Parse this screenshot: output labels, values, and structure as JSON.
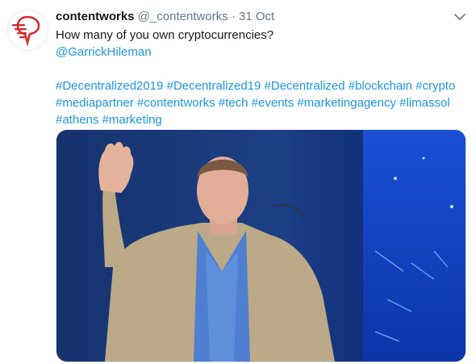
{
  "tweet": {
    "author_name": "contentworks",
    "author_handle": "@_contentworks",
    "separator": "·",
    "timestamp": "31 Oct",
    "text": "How many of you own cryptocurrencies?",
    "mention": "@GarrickHileman",
    "hashtags": [
      [
        "#Decentralized2019",
        "#Decentralized19",
        "#Decentralized",
        "#blockchain",
        "#crypto"
      ],
      [
        "#mediapartner",
        "#contentworks",
        "#tech",
        "#events",
        "#marketingagency",
        "#limassol"
      ],
      [
        "#athens",
        "#marketing"
      ]
    ],
    "avatar_icon": "contentworks-logo-icon",
    "menu_icon": "chevron-down-icon",
    "media_description_icon": "photo"
  },
  "colors": {
    "link": "#1b95e0",
    "secondary_text": "#657786",
    "logo_red": "#d7262b"
  }
}
